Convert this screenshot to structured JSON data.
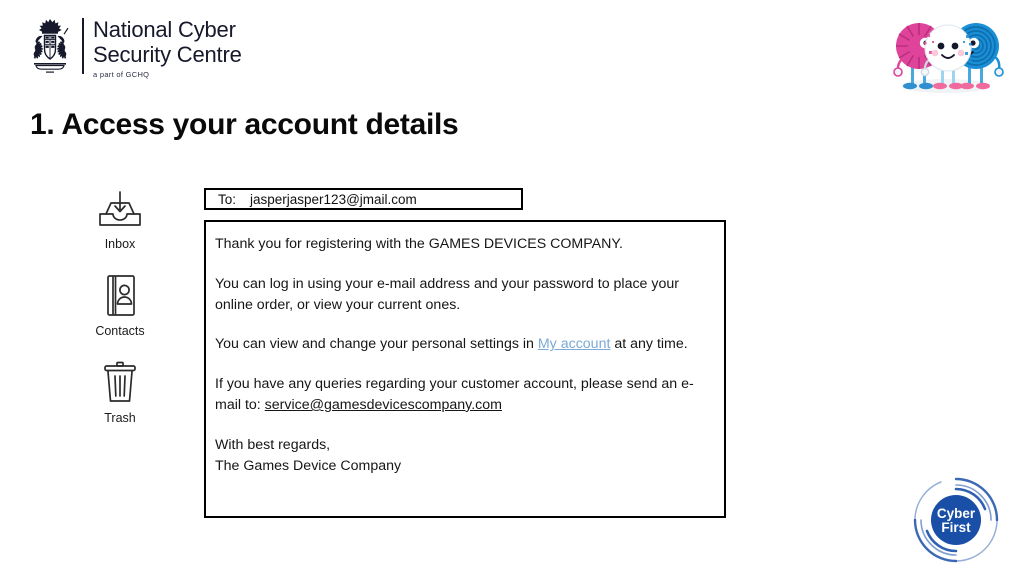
{
  "brand": {
    "crest_icon": "royal-coat-of-arms-crest",
    "line1": "National Cyber",
    "line2": "Security Centre",
    "subtitle": "a part of GCHQ",
    "text_color": "#16182b"
  },
  "slide": {
    "title": "1. Access your account details"
  },
  "mail_sidebar": {
    "items": [
      {
        "label": "Inbox",
        "icon": "inbox-tray-icon"
      },
      {
        "label": "Contacts",
        "icon": "contacts-book-icon"
      },
      {
        "label": "Trash",
        "icon": "trash-can-icon"
      }
    ]
  },
  "email": {
    "to_label": "To:",
    "to_value": "jasperjasper123@jmail.com",
    "body": {
      "p1": "Thank you for registering with the GAMES DEVICES COMPANY.",
      "p2": "You can log in using your e-mail address and your password to place your online order, or view your current ones.",
      "p3_before": "You can view and change your personal settings in ",
      "p3_link": "My account",
      "p3_after": " at any time.",
      "p4_before": "If you have any queries regarding your customer account, please send an e-mail to: ",
      "p4_link": "service@gamesdevicescompany.com",
      "p5_line1": "With best regards,",
      "p5_line2": "The Games Device Company"
    },
    "link_color": "#7ba9d6"
  },
  "mascots": {
    "icon": "cyber-mascots-illustration",
    "characters": [
      {
        "name": "pink-mascot",
        "color": "#e0449a"
      },
      {
        "name": "white-mascot",
        "color": "#ffffff"
      },
      {
        "name": "blue-mascot",
        "color": "#1b8fd6"
      }
    ]
  },
  "cyberfirst": {
    "icon": "cyberfirst-logo",
    "line1": "Cyber",
    "line2": "First",
    "color": "#1a4fa8"
  }
}
